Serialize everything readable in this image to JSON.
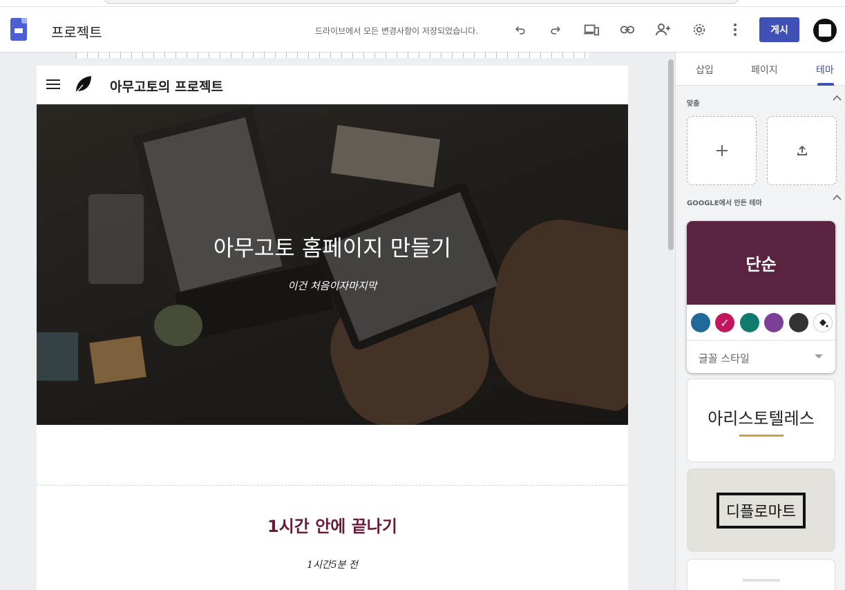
{
  "app": {
    "doc_title": "프로젝트",
    "save_status": "드라이브에서 모든 변경사항이 저장되었습니다.",
    "publish_label": "게시",
    "toolbar_icons": [
      "undo-icon",
      "redo-icon",
      "preview-devices-icon",
      "link-icon",
      "share-person-add-icon",
      "gear-icon",
      "more-vert-icon"
    ]
  },
  "site": {
    "name": "아무고토의 프로젝트",
    "hero_title": "아무고토 홈페이지 만들기",
    "hero_subtitle": "이건 처음이자마지막",
    "section_title": "1시간 안에 끝나기",
    "section_meta": "1시간5분 전"
  },
  "panel": {
    "tabs": [
      {
        "label": "삽입",
        "active": false
      },
      {
        "label": "페이지",
        "active": false
      },
      {
        "label": "테마",
        "active": true
      }
    ],
    "custom_label": "맞춤",
    "google_themes_label": "GOOGLE에서 만든 테마",
    "themes": {
      "simple": {
        "name": "단순",
        "band_color": "#5a2440",
        "swatches": [
          "#1f6a9a",
          "#c2185b",
          "#0f7b6c",
          "#7b3f98",
          "#333333"
        ],
        "selected_swatch": 1,
        "font_style_label": "글꼴 스타일"
      },
      "aristotle": {
        "name": "아리스토텔레스",
        "accent": "#c9a23a"
      },
      "diplomat": {
        "name": "디플로마트"
      }
    }
  },
  "colors": {
    "accent": "#3f51b5",
    "section_title": "#6a1b3a"
  }
}
